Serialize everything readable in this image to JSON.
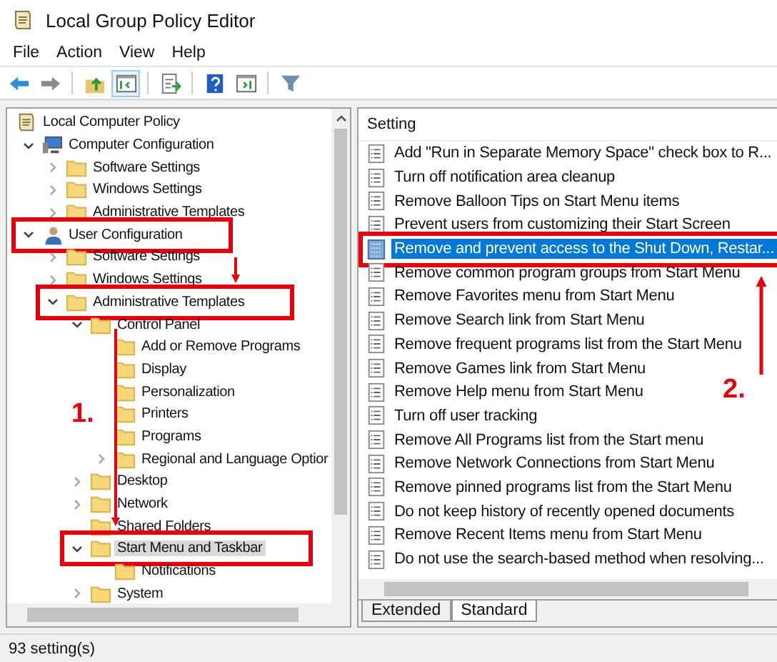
{
  "window": {
    "title": "Local Group Policy Editor"
  },
  "menu": [
    "File",
    "Action",
    "View",
    "Help"
  ],
  "toolbar": [
    {
      "kind": "back",
      "pressed": false
    },
    {
      "kind": "forward",
      "pressed": false
    },
    {
      "kind": "up",
      "pressed": false
    },
    {
      "kind": "tree",
      "pressed": true
    },
    {
      "kind": "export",
      "pressed": false
    },
    {
      "kind": "help",
      "pressed": false
    },
    {
      "kind": "pane",
      "pressed": false
    },
    {
      "kind": "filter",
      "pressed": false
    }
  ],
  "tree": [
    {
      "label": "Local Computer Policy",
      "kind": "policy",
      "selected": false,
      "marked": false,
      "children": [
        {
          "label": "Computer Configuration",
          "kind": "computer",
          "expanded": true,
          "selected": false,
          "marked": false,
          "children": [
            {
              "label": "Software Settings",
              "kind": "folder",
              "expanded": false,
              "selected": false,
              "marked": false
            },
            {
              "label": "Windows Settings",
              "kind": "folder",
              "expanded": false,
              "selected": false,
              "marked": false
            },
            {
              "label": "Administrative Templates",
              "kind": "folder",
              "expanded": false,
              "selected": false,
              "marked": false
            }
          ]
        },
        {
          "label": "User Configuration",
          "kind": "user",
          "expanded": true,
          "selected": false,
          "marked": true,
          "children": [
            {
              "label": "Software Settings",
              "kind": "folder",
              "expanded": false,
              "selected": false,
              "marked": false
            },
            {
              "label": "Windows Settings",
              "kind": "folder",
              "expanded": false,
              "selected": false,
              "marked": false
            },
            {
              "label": "Administrative Templates",
              "kind": "folder",
              "expanded": true,
              "selected": false,
              "marked": true,
              "children": [
                {
                  "label": "Control Panel",
                  "kind": "folder",
                  "expanded": true,
                  "selected": false,
                  "marked": false,
                  "children": [
                    {
                      "label": "Add or Remove Programs",
                      "kind": "folder",
                      "selected": false,
                      "marked": false
                    },
                    {
                      "label": "Display",
                      "kind": "folder",
                      "selected": false,
                      "marked": false
                    },
                    {
                      "label": "Personalization",
                      "kind": "folder",
                      "selected": false,
                      "marked": false
                    },
                    {
                      "label": "Printers",
                      "kind": "folder",
                      "selected": false,
                      "marked": false
                    },
                    {
                      "label": "Programs",
                      "kind": "folder",
                      "selected": false,
                      "marked": false
                    },
                    {
                      "label": "Regional and Language Optior",
                      "kind": "folder",
                      "expanded": false,
                      "selected": false,
                      "marked": false
                    }
                  ]
                },
                {
                  "label": "Desktop",
                  "kind": "folder",
                  "expanded": false,
                  "selected": false,
                  "marked": false
                },
                {
                  "label": "Network",
                  "kind": "folder",
                  "expanded": false,
                  "selected": false,
                  "marked": false
                },
                {
                  "label": "Shared Folders",
                  "kind": "folder",
                  "selected": false,
                  "marked": false
                },
                {
                  "label": "Start Menu and Taskbar",
                  "kind": "folder",
                  "expanded": true,
                  "selected": true,
                  "marked": true,
                  "children": [
                    {
                      "label": "Notifications",
                      "kind": "folder",
                      "selected": false,
                      "marked": false
                    }
                  ]
                },
                {
                  "label": "System",
                  "kind": "folder",
                  "expanded": false,
                  "selected": false,
                  "marked": false
                }
              ]
            }
          ]
        }
      ]
    }
  ],
  "settings": {
    "column": "Setting",
    "rows": [
      {
        "label": "Add \"Run in Separate Memory Space\" check box to R...",
        "selected": false,
        "marked": false
      },
      {
        "label": "Turn off notification area cleanup",
        "selected": false,
        "marked": false
      },
      {
        "label": "Remove Balloon Tips on Start Menu items",
        "selected": false,
        "marked": false
      },
      {
        "label": "Prevent users from customizing their Start Screen",
        "selected": false,
        "marked": false
      },
      {
        "label": "Remove and prevent access to the Shut Down, Restar...",
        "selected": true,
        "marked": true
      },
      {
        "label": "Remove common program groups from Start Menu",
        "selected": false,
        "marked": false
      },
      {
        "label": "Remove Favorites menu from Start Menu",
        "selected": false,
        "marked": false
      },
      {
        "label": "Remove Search link from Start Menu",
        "selected": false,
        "marked": false
      },
      {
        "label": "Remove frequent programs list from the Start Menu",
        "selected": false,
        "marked": false
      },
      {
        "label": "Remove Games link from Start Menu",
        "selected": false,
        "marked": false
      },
      {
        "label": "Remove Help menu from Start Menu",
        "selected": false,
        "marked": false
      },
      {
        "label": "Turn off user tracking",
        "selected": false,
        "marked": false
      },
      {
        "label": "Remove All Programs list from the Start menu",
        "selected": false,
        "marked": false
      },
      {
        "label": "Remove Network Connections from Start Menu",
        "selected": false,
        "marked": false
      },
      {
        "label": "Remove pinned programs list from the Start Menu",
        "selected": false,
        "marked": false
      },
      {
        "label": "Do not keep history of recently opened documents",
        "selected": false,
        "marked": false
      },
      {
        "label": "Remove Recent Items menu from Start Menu",
        "selected": false,
        "marked": false
      },
      {
        "label": "Do not use the search-based method when resolving...",
        "selected": false,
        "marked": false
      }
    ]
  },
  "tabs": [
    {
      "label": "Extended",
      "selected": false
    },
    {
      "label": "Standard",
      "selected": true
    }
  ],
  "annotations": [
    {
      "label": "1."
    },
    {
      "label": "2."
    }
  ],
  "status_bar": "93 setting(s)"
}
